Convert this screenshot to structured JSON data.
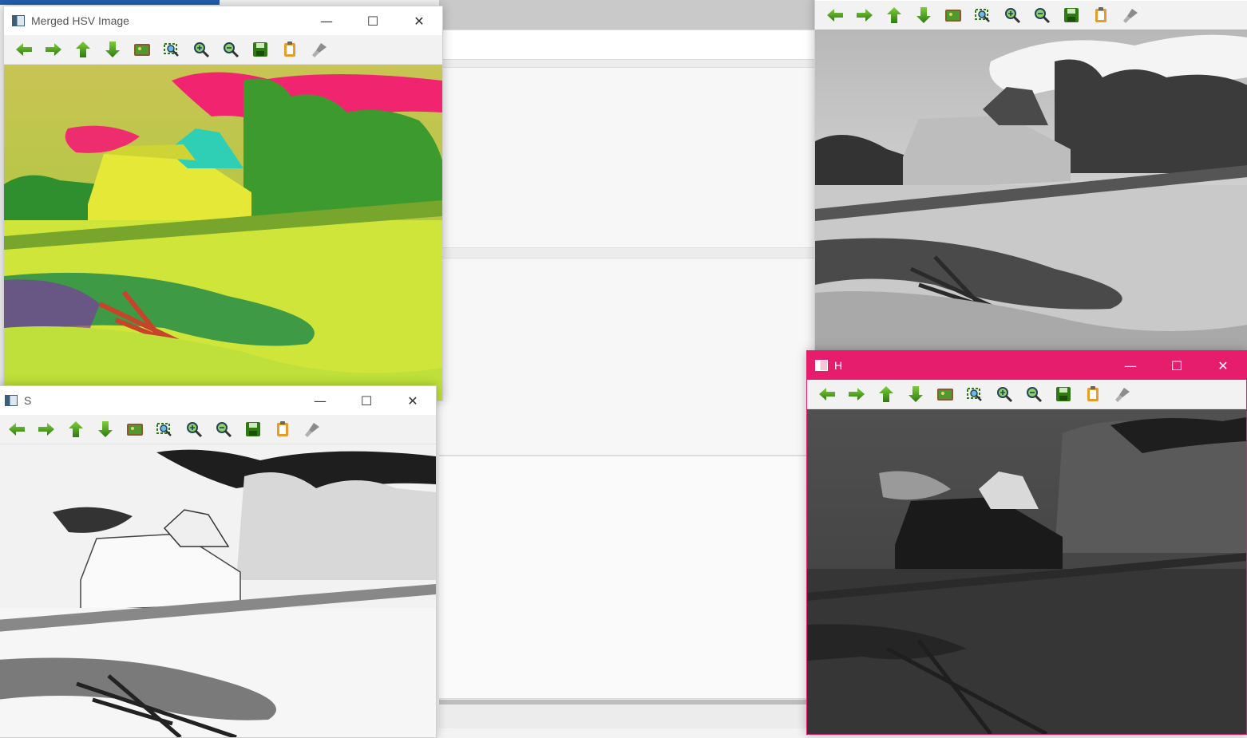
{
  "windows": {
    "merged": {
      "title": "Merged HSV Image"
    },
    "s": {
      "title": "S"
    },
    "h": {
      "title": "H"
    },
    "v": {
      "title": ""
    }
  },
  "toolbar_icons": [
    "pan-left-icon",
    "pan-right-icon",
    "pan-up-icon",
    "pan-down-icon",
    "zoom-image-icon",
    "zoom-region-icon",
    "zoom-in-icon",
    "zoom-out-icon",
    "save-icon",
    "copy-clipboard-icon",
    "properties-brush-icon"
  ],
  "window_controls": {
    "minimize": "—",
    "maximize": "☐",
    "close": "✕"
  },
  "colors": {
    "active_titlebar": "#e61c6d",
    "toolbar_icon_green": "#4a9a1c"
  }
}
